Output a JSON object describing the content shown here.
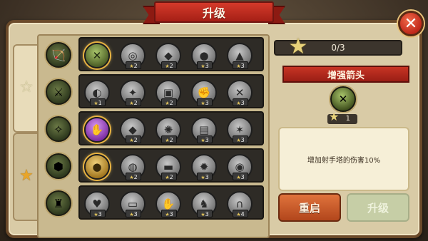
{
  "title": "升级",
  "close_label": "✕",
  "tabs": [
    {
      "icon": "star-outline-icon",
      "glyph": "☆"
    },
    {
      "icon": "star-filled-icon",
      "glyph": "★"
    }
  ],
  "stars_progress": "0/3",
  "detail": {
    "name": "增强箭头",
    "cost": "1",
    "description": "增加射手塔的伤害10%"
  },
  "buttons": {
    "reset": "重启",
    "upgrade": "升级"
  },
  "rows": [
    {
      "tower_icon": "archer-tower-icon",
      "tower_glyph": "🏹",
      "skills": [
        {
          "icon": "crossed-arrows-icon",
          "glyph": "✕",
          "cost": "",
          "style": "green ring"
        },
        {
          "icon": "target-icon",
          "glyph": "◎",
          "cost": "2",
          "style": ""
        },
        {
          "icon": "beast-icon",
          "glyph": "◆",
          "cost": "2",
          "style": ""
        },
        {
          "icon": "boar-icon",
          "glyph": "●",
          "cost": "3",
          "style": ""
        },
        {
          "icon": "wolf-icon",
          "glyph": "▲",
          "cost": "3",
          "style": ""
        }
      ]
    },
    {
      "tower_icon": "barracks-icon",
      "tower_glyph": "⚔",
      "skills": [
        {
          "icon": "helmet-icon",
          "glyph": "◐",
          "cost": "1",
          "style": ""
        },
        {
          "icon": "sword-icon",
          "glyph": "✦",
          "cost": "2",
          "style": ""
        },
        {
          "icon": "armor-icon",
          "glyph": "▣",
          "cost": "2",
          "style": ""
        },
        {
          "icon": "fist-icon",
          "glyph": "✊",
          "cost": "3",
          "style": ""
        },
        {
          "icon": "crossed-swords-icon",
          "glyph": "✕",
          "cost": "3",
          "style": ""
        }
      ]
    },
    {
      "tower_icon": "mage-tower-icon",
      "tower_glyph": "✧",
      "skills": [
        {
          "icon": "magic-hand-icon",
          "glyph": "✋",
          "cost": "",
          "style": "purple ring"
        },
        {
          "icon": "crystal-icon",
          "glyph": "◆",
          "cost": "2",
          "style": ""
        },
        {
          "icon": "sun-orb-icon",
          "glyph": "✺",
          "cost": "2",
          "style": ""
        },
        {
          "icon": "book-icon",
          "glyph": "▤",
          "cost": "3",
          "style": ""
        },
        {
          "icon": "creature-icon",
          "glyph": "✶",
          "cost": "3",
          "style": ""
        }
      ]
    },
    {
      "tower_icon": "artillery-icon",
      "tower_glyph": "⬢",
      "skills": [
        {
          "icon": "bomb-icon",
          "glyph": "●",
          "cost": "",
          "style": "gold ring"
        },
        {
          "icon": "rock-icon",
          "glyph": "◍",
          "cost": "2",
          "style": ""
        },
        {
          "icon": "anvil-icon",
          "glyph": "▬",
          "cost": "2",
          "style": ""
        },
        {
          "icon": "spiked-icon",
          "glyph": "✹",
          "cost": "3",
          "style": ""
        },
        {
          "icon": "barrel-icon",
          "glyph": "◉",
          "cost": "3",
          "style": ""
        }
      ]
    },
    {
      "tower_icon": "tower-defense-icon",
      "tower_glyph": "♜",
      "skills": [
        {
          "icon": "heart-armor-icon",
          "glyph": "♥",
          "cost": "3",
          "style": ""
        },
        {
          "icon": "treasure-icon",
          "glyph": "▭",
          "cost": "3",
          "style": ""
        },
        {
          "icon": "gauntlet-icon",
          "glyph": "✋",
          "cost": "3",
          "style": ""
        },
        {
          "icon": "knight-icon",
          "glyph": "♞",
          "cost": "3",
          "style": ""
        },
        {
          "icon": "arch-icon",
          "glyph": "∩",
          "cost": "4",
          "style": ""
        }
      ]
    }
  ]
}
